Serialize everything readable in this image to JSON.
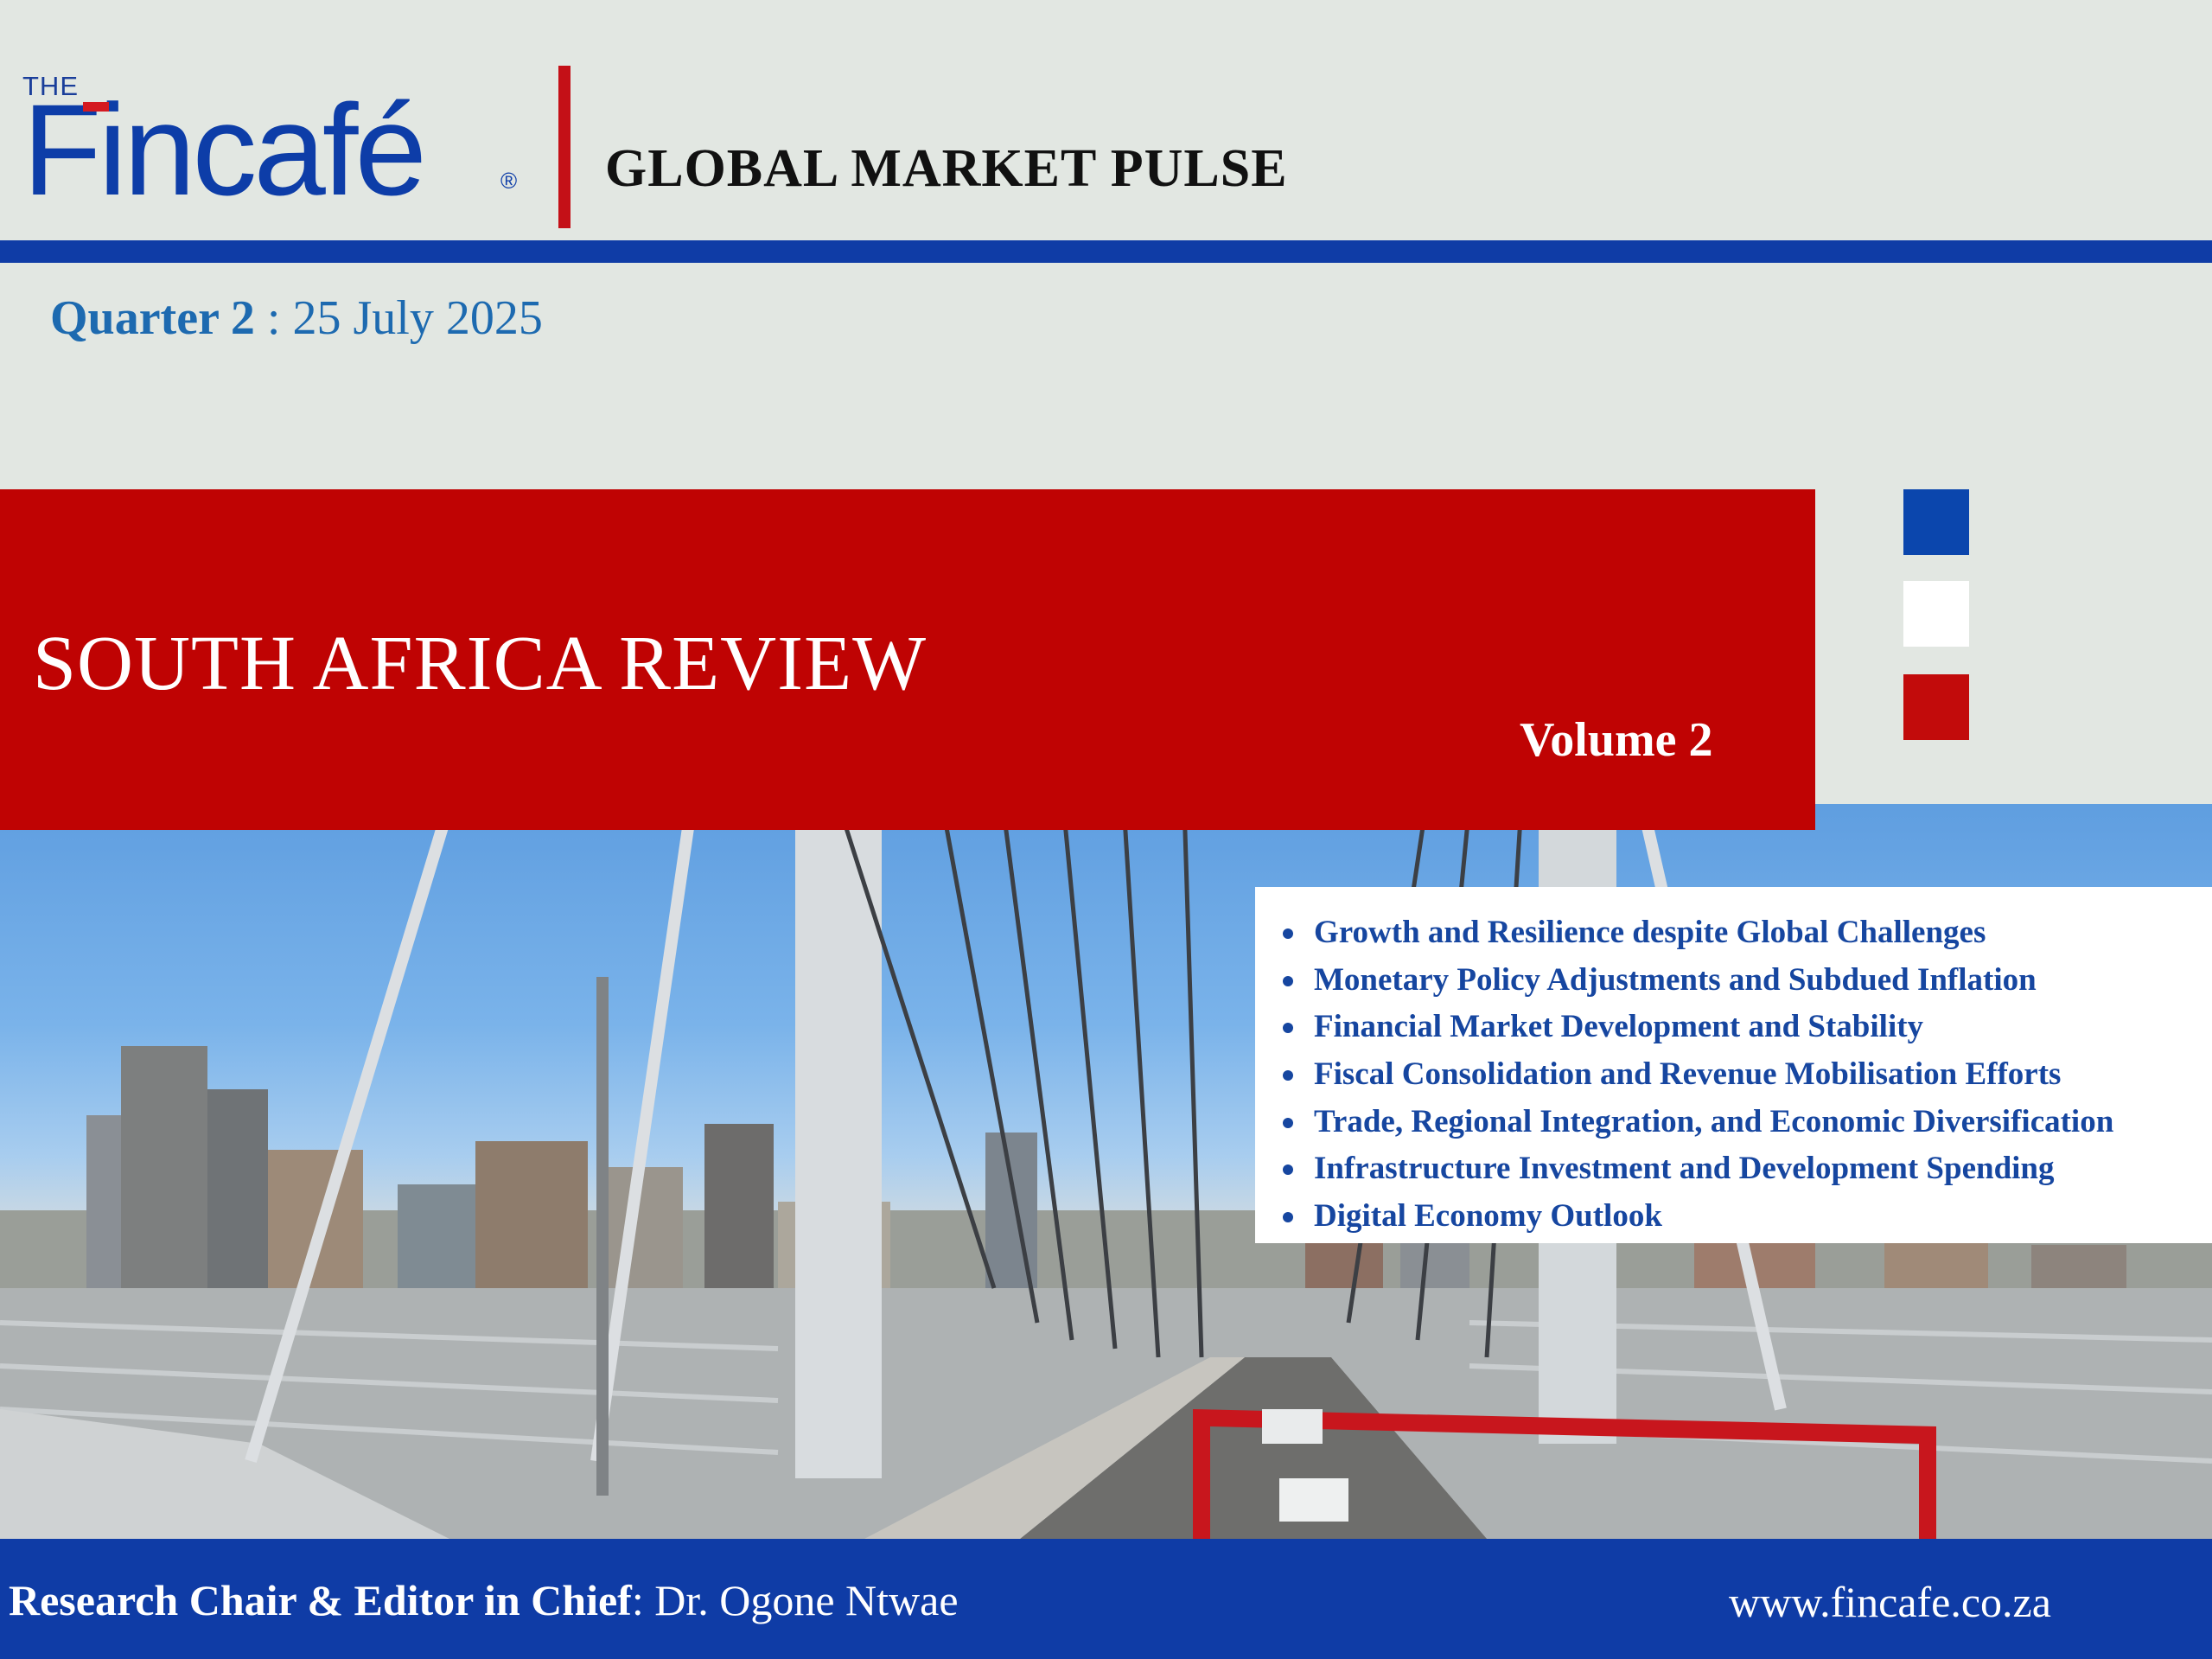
{
  "header": {
    "logo_small": "THE",
    "logo_word": "Fincafé",
    "logo_reg": "®",
    "series_title": "GLOBAL MARKET PULSE"
  },
  "date_line": {
    "quarter": "Quarter 2",
    "separator": " : ",
    "date": "25 July 2025"
  },
  "banner": {
    "title": "SOUTH AFRICA REVIEW",
    "volume": "Volume 2"
  },
  "topics": [
    "Growth and Resilience despite Global Challenges",
    "Monetary Policy Adjustments and Subdued Inflation",
    "Financial Market Development and Stability",
    "Fiscal Consolidation and Revenue Mobilisation Efforts",
    "Trade, Regional Integration, and Economic Diversification",
    "Infrastructure Investment and Development Spending",
    "Digital Economy Outlook"
  ],
  "footer": {
    "editor_label": "Research Chair & Editor in Chief",
    "editor_sep": ": ",
    "editor_name": "Dr. Ogone Ntwae",
    "website": "www.fincafe.co.za"
  },
  "colors": {
    "brand_blue": "#0f3ca6",
    "brand_red": "#bf0303",
    "topic_blue": "#1646a0",
    "date_blue": "#1d6ab0",
    "page_bg": "#e2e7e2"
  },
  "decorative_squares": [
    "blue",
    "white",
    "red"
  ],
  "photo_subject": "bridge-city-skyline-photo"
}
